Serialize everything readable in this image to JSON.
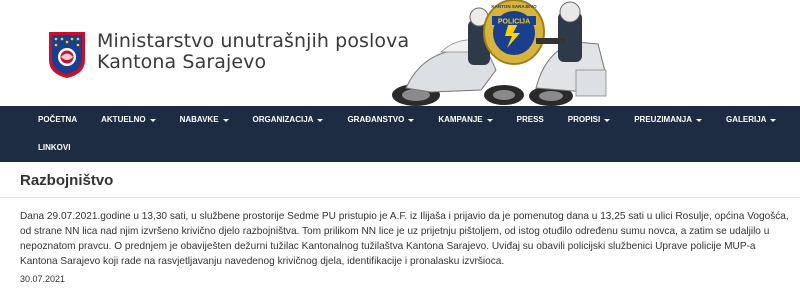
{
  "header": {
    "title_line1": "Ministarstvo unutrašnjih poslova",
    "title_line2": "Kantona Sarajevo",
    "badge_text": "POLICIJA",
    "badge_ring_text": "KANTON SARAJEVO"
  },
  "nav": {
    "items": [
      {
        "label": "Početna",
        "dropdown": false
      },
      {
        "label": "Aktuelno",
        "dropdown": true
      },
      {
        "label": "Nabavke",
        "dropdown": true
      },
      {
        "label": "Organizacija",
        "dropdown": true
      },
      {
        "label": "Građanstvo",
        "dropdown": true
      },
      {
        "label": "Kampanje",
        "dropdown": true
      },
      {
        "label": "Press",
        "dropdown": false
      },
      {
        "label": "Propisi",
        "dropdown": true
      },
      {
        "label": "Preuzimanja",
        "dropdown": true
      },
      {
        "label": "Galerija",
        "dropdown": true
      },
      {
        "label": "Linkovi",
        "dropdown": false
      }
    ]
  },
  "article": {
    "title": "Razbojništvo",
    "body": "Dana 29.07.2021.godine u 13,30 sati, u službene prostorije Sedme PU pristupio je A.F. iz Ilijaša i prijavio da je pomenutog dana u 13,25 sati u ulici Rosulje, općina Vogošća, od strane NN lica nad njim izvršeno krivično djelo razbojništva. Tom prilikom NN lice je uz prijetnju pištoljem, od istog otuđilo određenu sumu novca, a zatim se udaljilo u nepoznatom pravcu. O prednjem je obaviješten dežurni tužilac Kantonalnog tužilaštva Kantona Sarajevo. Uviđaj su obavili policijski službenici Uprave policije MUP-a Kantona Sarajevo koji rade na rasvjetljavanju navedenog krivičnog djela, identifikacije i pronalasku izvršioca.",
    "date": "30.07.2021"
  },
  "colors": {
    "navbar_bg": "#1d2c43",
    "nav_text": "#ffffff",
    "crest_blue": "#1b3f8f",
    "crest_red": "#c8102e",
    "badge_gold": "#d8b43a"
  }
}
